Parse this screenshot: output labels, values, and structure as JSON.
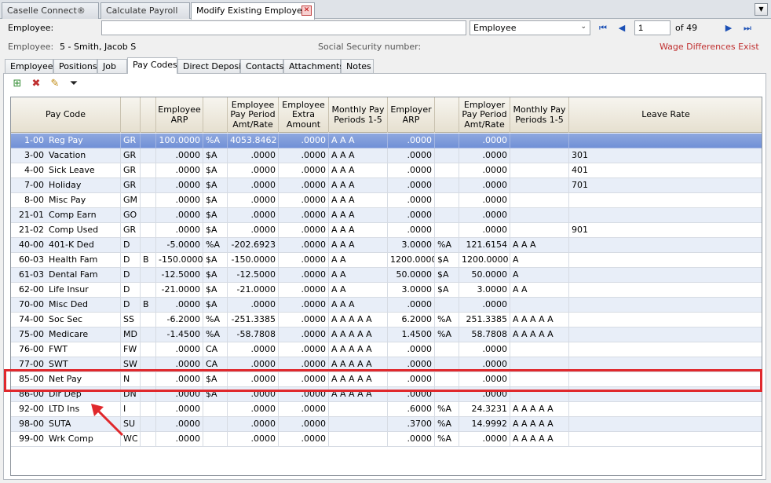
{
  "doc_tabs": [
    {
      "label": "Caselle Connect®",
      "active": false
    },
    {
      "label": "Calculate Payroll",
      "active": false
    },
    {
      "label": "Modify Existing Employees",
      "active": true
    }
  ],
  "employee_bar": {
    "label": "Employee:",
    "value": "",
    "lookup_select": "Employee",
    "page_value": "1",
    "page_of": "of 49"
  },
  "info": {
    "employee_label": "Employee:",
    "employee_value": "5 - Smith, Jacob S",
    "ssn_label": "Social Security number:",
    "warning": "Wage Differences Exist"
  },
  "section_tabs": [
    {
      "label": "Employee"
    },
    {
      "label": "Positions"
    },
    {
      "label": "Job"
    },
    {
      "label": "Pay Codes"
    },
    {
      "label": "Direct Deposit"
    },
    {
      "label": "Contacts"
    },
    {
      "label": "Attachments"
    },
    {
      "label": "Notes"
    }
  ],
  "toolbar_icons": [
    "add-icon",
    "delete-icon",
    "edit-icon",
    "filter-icon"
  ],
  "grid": {
    "headers": [
      "Pay Code",
      "",
      "",
      "Employee ARP",
      "",
      "Employee Pay Period Amt/Rate",
      "Employee Extra Amount",
      "Monthly Pay Periods 1-5",
      "Employer ARP",
      "",
      "Employer Pay Period Amt/Rate",
      "Monthly Pay Periods 1-5",
      "Leave Rate"
    ],
    "rows": [
      [
        "1-00",
        "Reg Pay",
        "GR",
        "",
        "100.0000",
        "%A",
        "4053.8462",
        ".0000",
        "A  A  A",
        ".0000",
        "",
        ".0000",
        "",
        ""
      ],
      [
        "3-00",
        "Vacation",
        "GR",
        "",
        ".0000",
        "$A",
        ".0000",
        ".0000",
        "A  A  A",
        ".0000",
        "",
        ".0000",
        "",
        "301"
      ],
      [
        "4-00",
        "Sick Leave",
        "GR",
        "",
        ".0000",
        "$A",
        ".0000",
        ".0000",
        "A  A  A",
        ".0000",
        "",
        ".0000",
        "",
        "401"
      ],
      [
        "7-00",
        "Holiday",
        "GR",
        "",
        ".0000",
        "$A",
        ".0000",
        ".0000",
        "A  A  A",
        ".0000",
        "",
        ".0000",
        "",
        "701"
      ],
      [
        "8-00",
        "Misc Pay",
        "GM",
        "",
        ".0000",
        "$A",
        ".0000",
        ".0000",
        "A  A  A",
        ".0000",
        "",
        ".0000",
        "",
        ""
      ],
      [
        "21-01",
        "Comp Earn",
        "GO",
        "",
        ".0000",
        "$A",
        ".0000",
        ".0000",
        "A  A  A",
        ".0000",
        "",
        ".0000",
        "",
        ""
      ],
      [
        "21-02",
        "Comp Used",
        "GR",
        "",
        ".0000",
        "$A",
        ".0000",
        ".0000",
        "A  A  A",
        ".0000",
        "",
        ".0000",
        "",
        "901"
      ],
      [
        "40-00",
        "401-K Ded",
        "D",
        "",
        "-5.0000",
        "%A",
        "-202.6923",
        ".0000",
        "A  A  A",
        "3.0000",
        "%A",
        "121.6154",
        "A  A  A",
        ""
      ],
      [
        "60-03",
        "Health Fam",
        "D",
        "B",
        "-150.0000",
        "$A",
        "-150.0000",
        ".0000",
        "A  A",
        "1200.0000",
        "$A",
        "1200.0000",
        "A",
        ""
      ],
      [
        "61-03",
        "Dental Fam",
        "D",
        "",
        "-12.5000",
        "$A",
        "-12.5000",
        ".0000",
        "A  A",
        "50.0000",
        "$A",
        "50.0000",
        "A",
        ""
      ],
      [
        "62-00",
        "Life Insur",
        "D",
        "",
        "-21.0000",
        "$A",
        "-21.0000",
        ".0000",
        "A  A",
        "3.0000",
        "$A",
        "3.0000",
        "A  A",
        ""
      ],
      [
        "70-00",
        "Misc Ded",
        "D",
        "B",
        ".0000",
        "$A",
        ".0000",
        ".0000",
        "A  A  A",
        ".0000",
        "",
        ".0000",
        "",
        ""
      ],
      [
        "74-00",
        "Soc Sec",
        "SS",
        "",
        "-6.2000",
        "%A",
        "-251.3385",
        ".0000",
        "A  A  A  A  A",
        "6.2000",
        "%A",
        "251.3385",
        "A  A  A  A  A",
        ""
      ],
      [
        "75-00",
        "Medicare",
        "MD",
        "",
        "-1.4500",
        "%A",
        "-58.7808",
        ".0000",
        "A  A  A  A  A",
        "1.4500",
        "%A",
        "58.7808",
        "A  A  A  A  A",
        ""
      ],
      [
        "76-00",
        "FWT",
        "FW",
        "",
        ".0000",
        "CA",
        ".0000",
        ".0000",
        "A  A  A  A  A",
        ".0000",
        "",
        ".0000",
        "",
        ""
      ],
      [
        "77-00",
        "SWT",
        "SW",
        "",
        ".0000",
        "CA",
        ".0000",
        ".0000",
        "A  A  A  A  A",
        ".0000",
        "",
        ".0000",
        "",
        ""
      ],
      [
        "85-00",
        "Net Pay",
        "N",
        "",
        ".0000",
        "$A",
        ".0000",
        ".0000",
        "A  A  A  A  A",
        ".0000",
        "",
        ".0000",
        "",
        ""
      ],
      [
        "86-00",
        "Dir Dep",
        "DN",
        "",
        ".0000",
        "$A",
        ".0000",
        ".0000",
        "A  A  A  A  A",
        ".0000",
        "",
        ".0000",
        "",
        ""
      ],
      [
        "92-00",
        "LTD Ins",
        "I",
        "",
        ".0000",
        "",
        ".0000",
        ".0000",
        "",
        ".6000",
        "%A",
        "24.3231",
        "A  A  A  A  A",
        ""
      ],
      [
        "98-00",
        "SUTA",
        "SU",
        "",
        ".0000",
        "",
        ".0000",
        ".0000",
        "",
        ".3700",
        "%A",
        "14.9992",
        "A  A  A  A  A",
        ""
      ],
      [
        "99-00",
        "Wrk Comp",
        "WC",
        "",
        ".0000",
        "",
        ".0000",
        ".0000",
        "",
        ".0000",
        "%A",
        ".0000",
        "A  A  A  A  A",
        ""
      ]
    ],
    "selected_row": 0,
    "highlighted_row": 16
  },
  "colors": {
    "highlight": "#e0282c",
    "selection": "#7a97d9",
    "warning": "#c03030"
  }
}
